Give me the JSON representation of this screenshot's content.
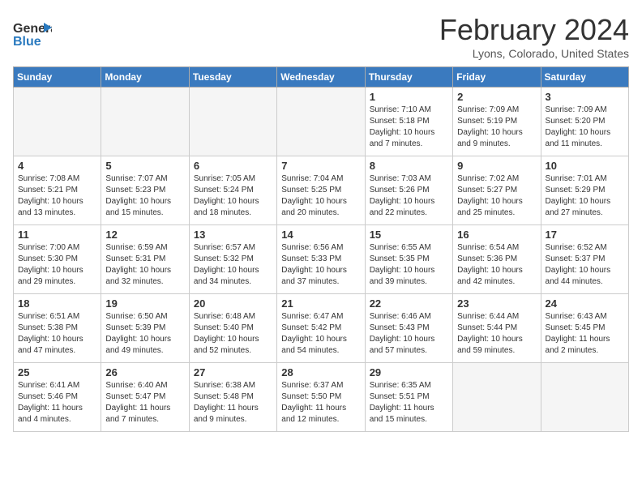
{
  "header": {
    "logo_general": "General",
    "logo_blue": "Blue",
    "title": "February 2024",
    "location": "Lyons, Colorado, United States"
  },
  "days_of_week": [
    "Sunday",
    "Monday",
    "Tuesday",
    "Wednesday",
    "Thursday",
    "Friday",
    "Saturday"
  ],
  "weeks": [
    [
      {
        "day": "",
        "info": ""
      },
      {
        "day": "",
        "info": ""
      },
      {
        "day": "",
        "info": ""
      },
      {
        "day": "",
        "info": ""
      },
      {
        "day": "1",
        "info": "Sunrise: 7:10 AM\nSunset: 5:18 PM\nDaylight: 10 hours\nand 7 minutes."
      },
      {
        "day": "2",
        "info": "Sunrise: 7:09 AM\nSunset: 5:19 PM\nDaylight: 10 hours\nand 9 minutes."
      },
      {
        "day": "3",
        "info": "Sunrise: 7:09 AM\nSunset: 5:20 PM\nDaylight: 10 hours\nand 11 minutes."
      }
    ],
    [
      {
        "day": "4",
        "info": "Sunrise: 7:08 AM\nSunset: 5:21 PM\nDaylight: 10 hours\nand 13 minutes."
      },
      {
        "day": "5",
        "info": "Sunrise: 7:07 AM\nSunset: 5:23 PM\nDaylight: 10 hours\nand 15 minutes."
      },
      {
        "day": "6",
        "info": "Sunrise: 7:05 AM\nSunset: 5:24 PM\nDaylight: 10 hours\nand 18 minutes."
      },
      {
        "day": "7",
        "info": "Sunrise: 7:04 AM\nSunset: 5:25 PM\nDaylight: 10 hours\nand 20 minutes."
      },
      {
        "day": "8",
        "info": "Sunrise: 7:03 AM\nSunset: 5:26 PM\nDaylight: 10 hours\nand 22 minutes."
      },
      {
        "day": "9",
        "info": "Sunrise: 7:02 AM\nSunset: 5:27 PM\nDaylight: 10 hours\nand 25 minutes."
      },
      {
        "day": "10",
        "info": "Sunrise: 7:01 AM\nSunset: 5:29 PM\nDaylight: 10 hours\nand 27 minutes."
      }
    ],
    [
      {
        "day": "11",
        "info": "Sunrise: 7:00 AM\nSunset: 5:30 PM\nDaylight: 10 hours\nand 29 minutes."
      },
      {
        "day": "12",
        "info": "Sunrise: 6:59 AM\nSunset: 5:31 PM\nDaylight: 10 hours\nand 32 minutes."
      },
      {
        "day": "13",
        "info": "Sunrise: 6:57 AM\nSunset: 5:32 PM\nDaylight: 10 hours\nand 34 minutes."
      },
      {
        "day": "14",
        "info": "Sunrise: 6:56 AM\nSunset: 5:33 PM\nDaylight: 10 hours\nand 37 minutes."
      },
      {
        "day": "15",
        "info": "Sunrise: 6:55 AM\nSunset: 5:35 PM\nDaylight: 10 hours\nand 39 minutes."
      },
      {
        "day": "16",
        "info": "Sunrise: 6:54 AM\nSunset: 5:36 PM\nDaylight: 10 hours\nand 42 minutes."
      },
      {
        "day": "17",
        "info": "Sunrise: 6:52 AM\nSunset: 5:37 PM\nDaylight: 10 hours\nand 44 minutes."
      }
    ],
    [
      {
        "day": "18",
        "info": "Sunrise: 6:51 AM\nSunset: 5:38 PM\nDaylight: 10 hours\nand 47 minutes."
      },
      {
        "day": "19",
        "info": "Sunrise: 6:50 AM\nSunset: 5:39 PM\nDaylight: 10 hours\nand 49 minutes."
      },
      {
        "day": "20",
        "info": "Sunrise: 6:48 AM\nSunset: 5:40 PM\nDaylight: 10 hours\nand 52 minutes."
      },
      {
        "day": "21",
        "info": "Sunrise: 6:47 AM\nSunset: 5:42 PM\nDaylight: 10 hours\nand 54 minutes."
      },
      {
        "day": "22",
        "info": "Sunrise: 6:46 AM\nSunset: 5:43 PM\nDaylight: 10 hours\nand 57 minutes."
      },
      {
        "day": "23",
        "info": "Sunrise: 6:44 AM\nSunset: 5:44 PM\nDaylight: 10 hours\nand 59 minutes."
      },
      {
        "day": "24",
        "info": "Sunrise: 6:43 AM\nSunset: 5:45 PM\nDaylight: 11 hours\nand 2 minutes."
      }
    ],
    [
      {
        "day": "25",
        "info": "Sunrise: 6:41 AM\nSunset: 5:46 PM\nDaylight: 11 hours\nand 4 minutes."
      },
      {
        "day": "26",
        "info": "Sunrise: 6:40 AM\nSunset: 5:47 PM\nDaylight: 11 hours\nand 7 minutes."
      },
      {
        "day": "27",
        "info": "Sunrise: 6:38 AM\nSunset: 5:48 PM\nDaylight: 11 hours\nand 9 minutes."
      },
      {
        "day": "28",
        "info": "Sunrise: 6:37 AM\nSunset: 5:50 PM\nDaylight: 11 hours\nand 12 minutes."
      },
      {
        "day": "29",
        "info": "Sunrise: 6:35 AM\nSunset: 5:51 PM\nDaylight: 11 hours\nand 15 minutes."
      },
      {
        "day": "",
        "info": ""
      },
      {
        "day": "",
        "info": ""
      }
    ]
  ]
}
